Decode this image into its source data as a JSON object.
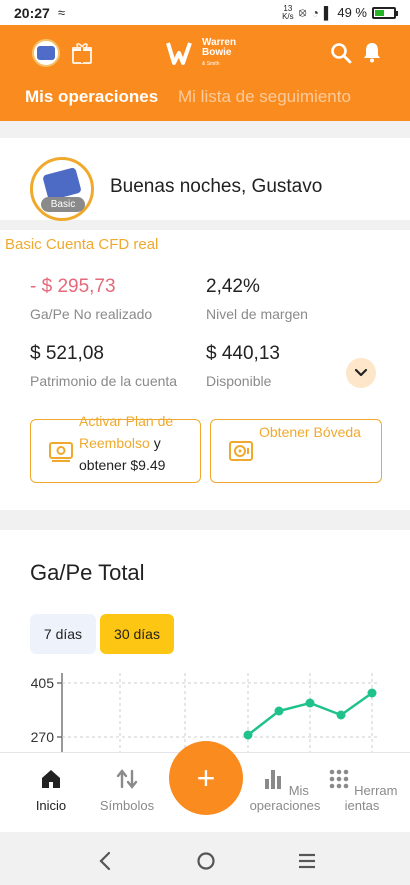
{
  "status_bar": {
    "time": "20:27",
    "speed_value": "13",
    "speed_unit": "K/s",
    "battery": "49 %",
    "battery_level": 0.49
  },
  "header": {
    "brand_line1": "Warren",
    "brand_line2": "Bowie",
    "brand_line3": "& Smith",
    "tabs": [
      {
        "label": "Mis operaciones",
        "active": true
      },
      {
        "label": "Mi lista de seguimiento",
        "active": false
      }
    ]
  },
  "greeting": {
    "badge": "Basic",
    "text": "Buenas noches, Gustavo"
  },
  "account": {
    "title": "Basic Cuenta CFD real",
    "unrealized_value": "- $ 295,73",
    "unrealized_label": "Ga/Pe No realizado",
    "margin_value": "2,42%",
    "margin_label": "Nivel de margen",
    "equity_value": "$ 521,08",
    "equity_label": "Patrimonio de la cuenta",
    "available_value": "$ 440,13",
    "available_label": "Disponible"
  },
  "actions": {
    "rebate_link": "Activar Plan de Reembolso",
    "rebate_suffix": " y obtener $9.49",
    "vault_link": "Obtener Bóveda"
  },
  "pnl": {
    "title": "Ga/Pe Total",
    "range_7": "7 días",
    "range_30": "30 días"
  },
  "chart_data": {
    "type": "line",
    "title": "",
    "xlabel": "",
    "ylabel": "",
    "y_ticks": [
      "405",
      "270"
    ],
    "ylim": [
      245,
      420
    ],
    "x": [
      1,
      2,
      3,
      4,
      5
    ],
    "values": [
      275,
      335,
      355,
      325,
      380
    ],
    "colors": {
      "line": "#1fc28b"
    },
    "grid": true
  },
  "bottom_nav": {
    "items": [
      {
        "label": "Inicio",
        "active": true
      },
      {
        "label": "Símbolos",
        "active": false
      },
      {
        "label": "Mis operaciones",
        "active": false
      },
      {
        "label": "Herramientas",
        "active": false
      }
    ],
    "fab": "+"
  },
  "theme": {
    "accent": "#fa8b1f",
    "gold": "#f0a92d",
    "negative": "#e5697a",
    "highlight": "#fdc612"
  }
}
